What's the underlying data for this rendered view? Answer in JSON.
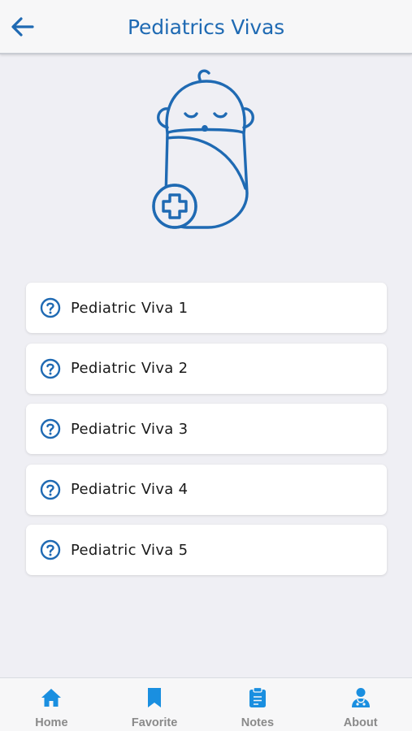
{
  "header": {
    "title": "Pediatrics Vivas",
    "back_icon": "arrow-left-icon"
  },
  "hero": {
    "icon": "swaddled-baby-medical-icon"
  },
  "vivas": [
    {
      "label": "Pediatric Viva 1",
      "icon": "question-circle-icon"
    },
    {
      "label": "Pediatric Viva 2",
      "icon": "question-circle-icon"
    },
    {
      "label": "Pediatric Viva 3",
      "icon": "question-circle-icon"
    },
    {
      "label": "Pediatric Viva 4",
      "icon": "question-circle-icon"
    },
    {
      "label": "Pediatric Viva 5",
      "icon": "question-circle-icon"
    }
  ],
  "bottom_nav": [
    {
      "label": "Home",
      "icon": "home-icon"
    },
    {
      "label": "Favorite",
      "icon": "bookmark-icon"
    },
    {
      "label": "Notes",
      "icon": "clipboard-icon"
    },
    {
      "label": "About",
      "icon": "doctor-icon"
    }
  ],
  "colors": {
    "accent": "#1f6ab3",
    "nav_icon": "#1a8fe0",
    "background": "#efeff4"
  }
}
